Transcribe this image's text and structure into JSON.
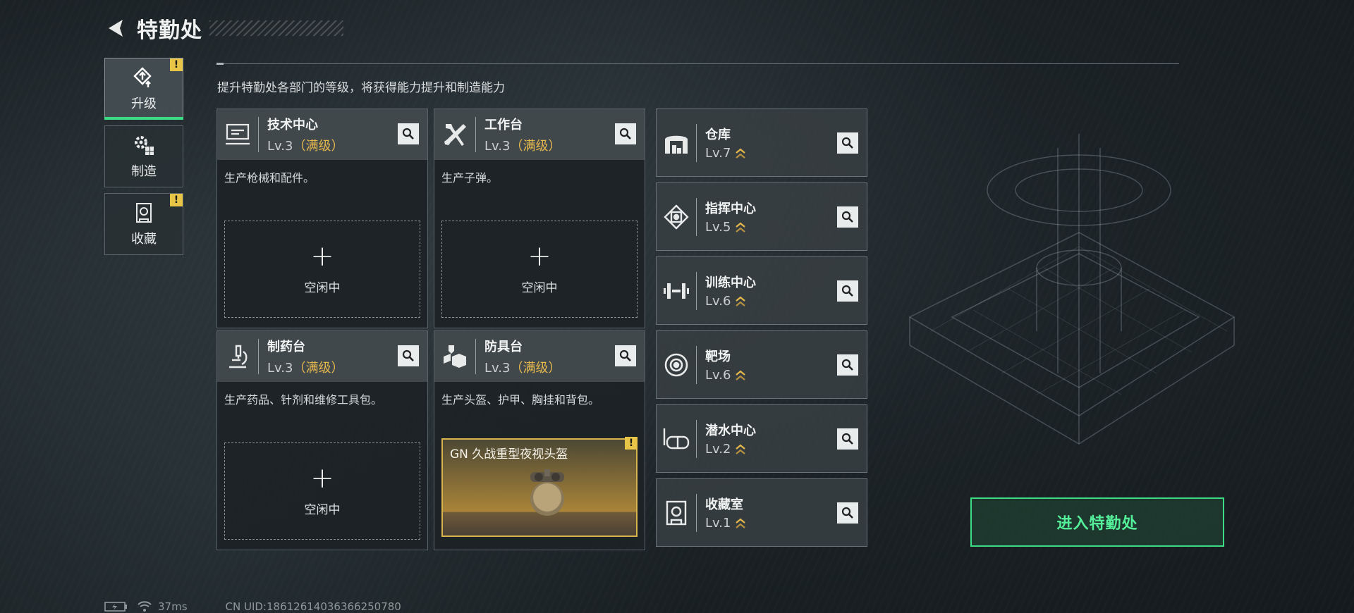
{
  "header": {
    "title": "特勤处"
  },
  "side_nav": [
    {
      "label": "升级",
      "icon": "upgrade-icon",
      "active": true,
      "alert": true
    },
    {
      "label": "制造",
      "icon": "gears-icon",
      "active": false,
      "alert": false
    },
    {
      "label": "收藏",
      "icon": "collection-icon",
      "active": false,
      "alert": true
    }
  ],
  "alert_mark": "!",
  "subtitle": "提升特勤处各部门的等级，将获得能力提升和制造能力",
  "workbenches": [
    {
      "name": "技术中心",
      "level": "Lv.3",
      "max": "（满级）",
      "desc": "生产枪械和配件。",
      "slot": "idle",
      "icon": "computer-icon"
    },
    {
      "name": "工作台",
      "level": "Lv.3",
      "max": "（满级）",
      "desc": "生产子弹。",
      "slot": "idle",
      "icon": "tools-icon"
    },
    {
      "name": "制药台",
      "level": "Lv.3",
      "max": "（满级）",
      "desc": "生产药品、针剂和维修工具包。",
      "slot": "idle",
      "icon": "microscope-icon"
    },
    {
      "name": "防具台",
      "level": "Lv.3",
      "max": "（满级）",
      "desc": "生产头盔、护甲、胸挂和背包。",
      "slot": "item",
      "item_name": "GN 久战重型夜视头盔",
      "icon": "armor-icon"
    }
  ],
  "idle": {
    "plus": "+",
    "text": "空闲中"
  },
  "facilities": [
    {
      "name": "仓库",
      "level": "Lv.7",
      "icon": "warehouse-icon"
    },
    {
      "name": "指挥中心",
      "level": "Lv.5",
      "icon": "command-icon"
    },
    {
      "name": "训练中心",
      "level": "Lv.6",
      "icon": "dumbbell-icon"
    },
    {
      "name": "靶场",
      "level": "Lv.6",
      "icon": "target-icon"
    },
    {
      "name": "潜水中心",
      "level": "Lv.2",
      "icon": "diving-mask-icon"
    },
    {
      "name": "收藏室",
      "level": "Lv.1",
      "icon": "vault-icon"
    }
  ],
  "enter_button": "进入特勤处",
  "status": {
    "latency": "37ms",
    "uid": "CN UID:18612614036366250780"
  },
  "colors": {
    "accent_green": "#3ddc84",
    "max_gold": "#e7b94c",
    "alert_yellow": "#e8c547"
  }
}
